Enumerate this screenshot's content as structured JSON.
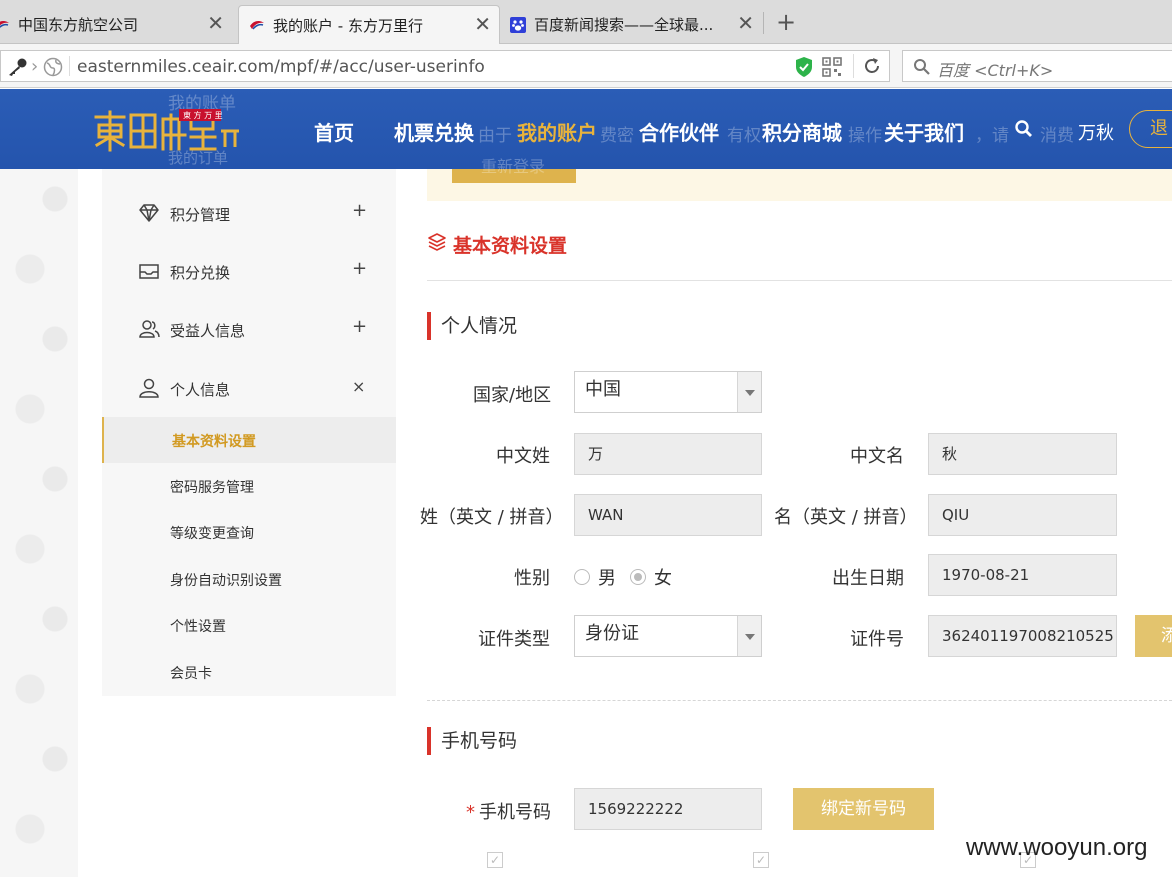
{
  "browser": {
    "tabs": [
      {
        "title": "中国东方航空公司",
        "active": false
      },
      {
        "title": "我的账户 - 东方万里行",
        "active": true
      },
      {
        "title": "百度新闻搜索——全球最...",
        "active": false
      }
    ],
    "address": "easternmiles.ceair.com/mpf/#/acc/user-userinfo",
    "search_placeholder": "百度 <Ctrl+K>"
  },
  "nav": {
    "items": [
      "首页",
      "机票兑换",
      "我的账户",
      "合作伙伴",
      "积分商城",
      "关于我们"
    ],
    "active_index": 2,
    "user": "万秋",
    "logout": "退"
  },
  "ghost": {
    "notice_fragments": [
      "由于",
      "费密",
      "有权",
      "操作",
      "，请",
      "消费"
    ],
    "sidebar_top": [
      "我的账单",
      "我的订单"
    ],
    "relogin": "重新登录"
  },
  "sidebar": {
    "menus": [
      {
        "label": "积分管理",
        "toggle": "+",
        "icon": "diamond-icon"
      },
      {
        "label": "积分兑换",
        "toggle": "+",
        "icon": "inbox-icon"
      },
      {
        "label": "受益人信息",
        "toggle": "+",
        "icon": "beneficiary-icon"
      },
      {
        "label": "个人信息",
        "toggle": "×",
        "icon": "user-icon"
      }
    ],
    "subitems": [
      "基本资料设置",
      "密码服务管理",
      "等级变更查询",
      "身份自动识别设置",
      "个性设置",
      "会员卡"
    ],
    "active_sub": 0
  },
  "main": {
    "section_title": "基本资料设置",
    "personal": {
      "heading": "个人情况",
      "country_label": "国家/地区",
      "country_value": "中国",
      "cn_surname_label": "中文姓",
      "cn_surname_value": "万",
      "cn_name_label": "中文名",
      "cn_name_value": "秋",
      "en_surname_label": "姓（英文 / 拼音）",
      "en_surname_value": "WAN",
      "en_name_label": "名（英文 / 拼音）",
      "en_name_value": "QIU",
      "gender_label": "性别",
      "gender_male": "男",
      "gender_female": "女",
      "birth_label": "出生日期",
      "birth_value": "1970-08-21",
      "idtype_label": "证件类型",
      "idtype_value": "身份证",
      "idno_label": "证件号",
      "idno_value": "362401197008210525",
      "add_btn": "添"
    },
    "phone": {
      "heading": "手机号码",
      "required_mark": "*",
      "label": "手机号码",
      "value": "1569222222",
      "bind_btn": "绑定新号码"
    }
  },
  "watermark": "www.wooyun.org"
}
